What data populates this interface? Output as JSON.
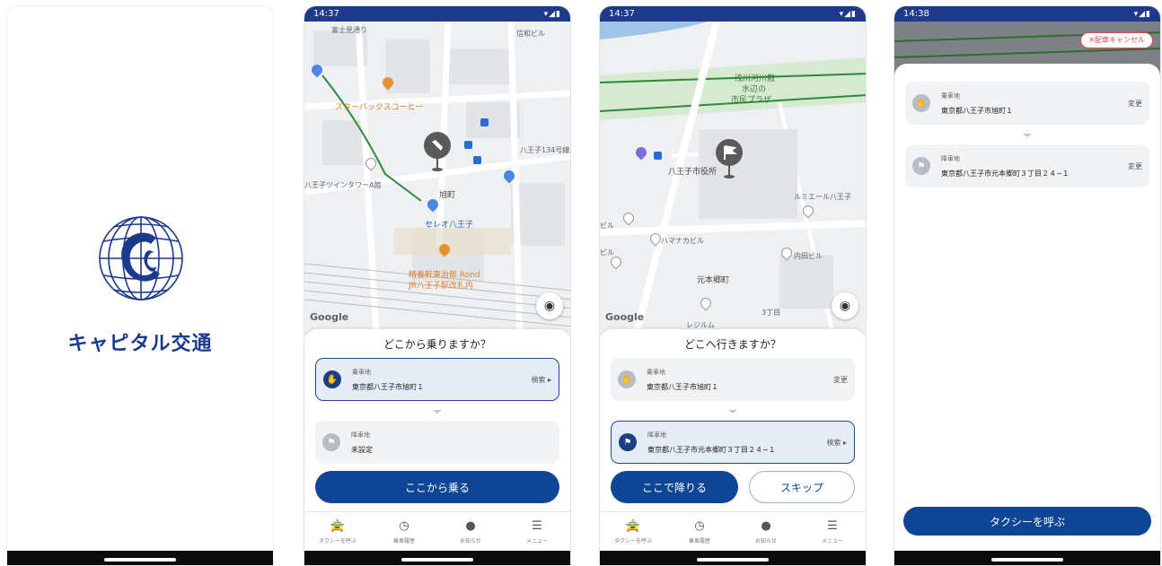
{
  "splash": {
    "brand_name": "キャピタル交通"
  },
  "screen2": {
    "time": "14:37",
    "status_icons": "▾◢▮",
    "map_labels": {
      "street1": "富士見通り",
      "building1": "信和ビル",
      "starbucks": "スターバックスコーヒー",
      "hachioji134": "八王子134号線",
      "twin_tower": "八王子ツインタワーA館",
      "asahicho": "旭町",
      "cereo": "セレオ八王子",
      "restaurant1": "精養軒東治郎 Rond",
      "restaurant2": "JR八王子駅改札内",
      "google": "Google"
    },
    "sheet_title": "どこから乗りますか？",
    "pickup_label": "乗車地",
    "pickup_value": "東京都八王子市旭町１",
    "pickup_action": "検索 ▸",
    "dropoff_label": "降車地",
    "dropoff_value": "未設定",
    "primary_button": "ここから乗る"
  },
  "screen3": {
    "time": "14:37",
    "status_icons": "▾◢▮",
    "map_labels": {
      "plaza1": "浅川河川敷",
      "plaza2": "水辺の",
      "plaza3": "市民プラザ",
      "city_hall": "八王子市役所",
      "lumiere": "ルミエール八王子",
      "hamanaka": "ハマナカビル",
      "uchida": "内田ビル",
      "motohongo": "元本郷町",
      "sanchome": "3丁目",
      "residence": "レジルム",
      "building_a": "ビル",
      "building_b": "ビル",
      "google": "Google"
    },
    "sheet_title": "どこへ行きますか？",
    "pickup_label": "乗車地",
    "pickup_value": "東京都八王子市旭町１",
    "pickup_action": "変更",
    "dropoff_label": "降車地",
    "dropoff_value": "東京都八王子市元本郷町３丁目２４−１",
    "dropoff_action": "検索 ▸",
    "primary_button": "ここで降りる",
    "secondary_button": "スキップ"
  },
  "screen4": {
    "time": "14:38",
    "status_icons": "▾◢▮",
    "cancel_button": "✕配車キャンセル",
    "pickup_label": "乗車地",
    "pickup_value": "東京都八王子市旭町１",
    "pickup_action": "変更",
    "dropoff_label": "降車地",
    "dropoff_value": "東京都八王子市元本郷町３丁目２４−１",
    "dropoff_action": "変更",
    "call_button": "タクシーを呼ぶ"
  },
  "tabbar": {
    "taxi": "タクシーを呼ぶ",
    "history": "乗車履歴",
    "notice": "お知らせ",
    "menu": "メニュー"
  },
  "icons": {
    "taxi": "car-icon",
    "history": "clock-icon",
    "notice": "chat-icon",
    "menu": "menu-icon"
  },
  "colors": {
    "primary": "#0f4595",
    "status_bar": "#1f3a8a",
    "cancel": "#e04a4a"
  }
}
